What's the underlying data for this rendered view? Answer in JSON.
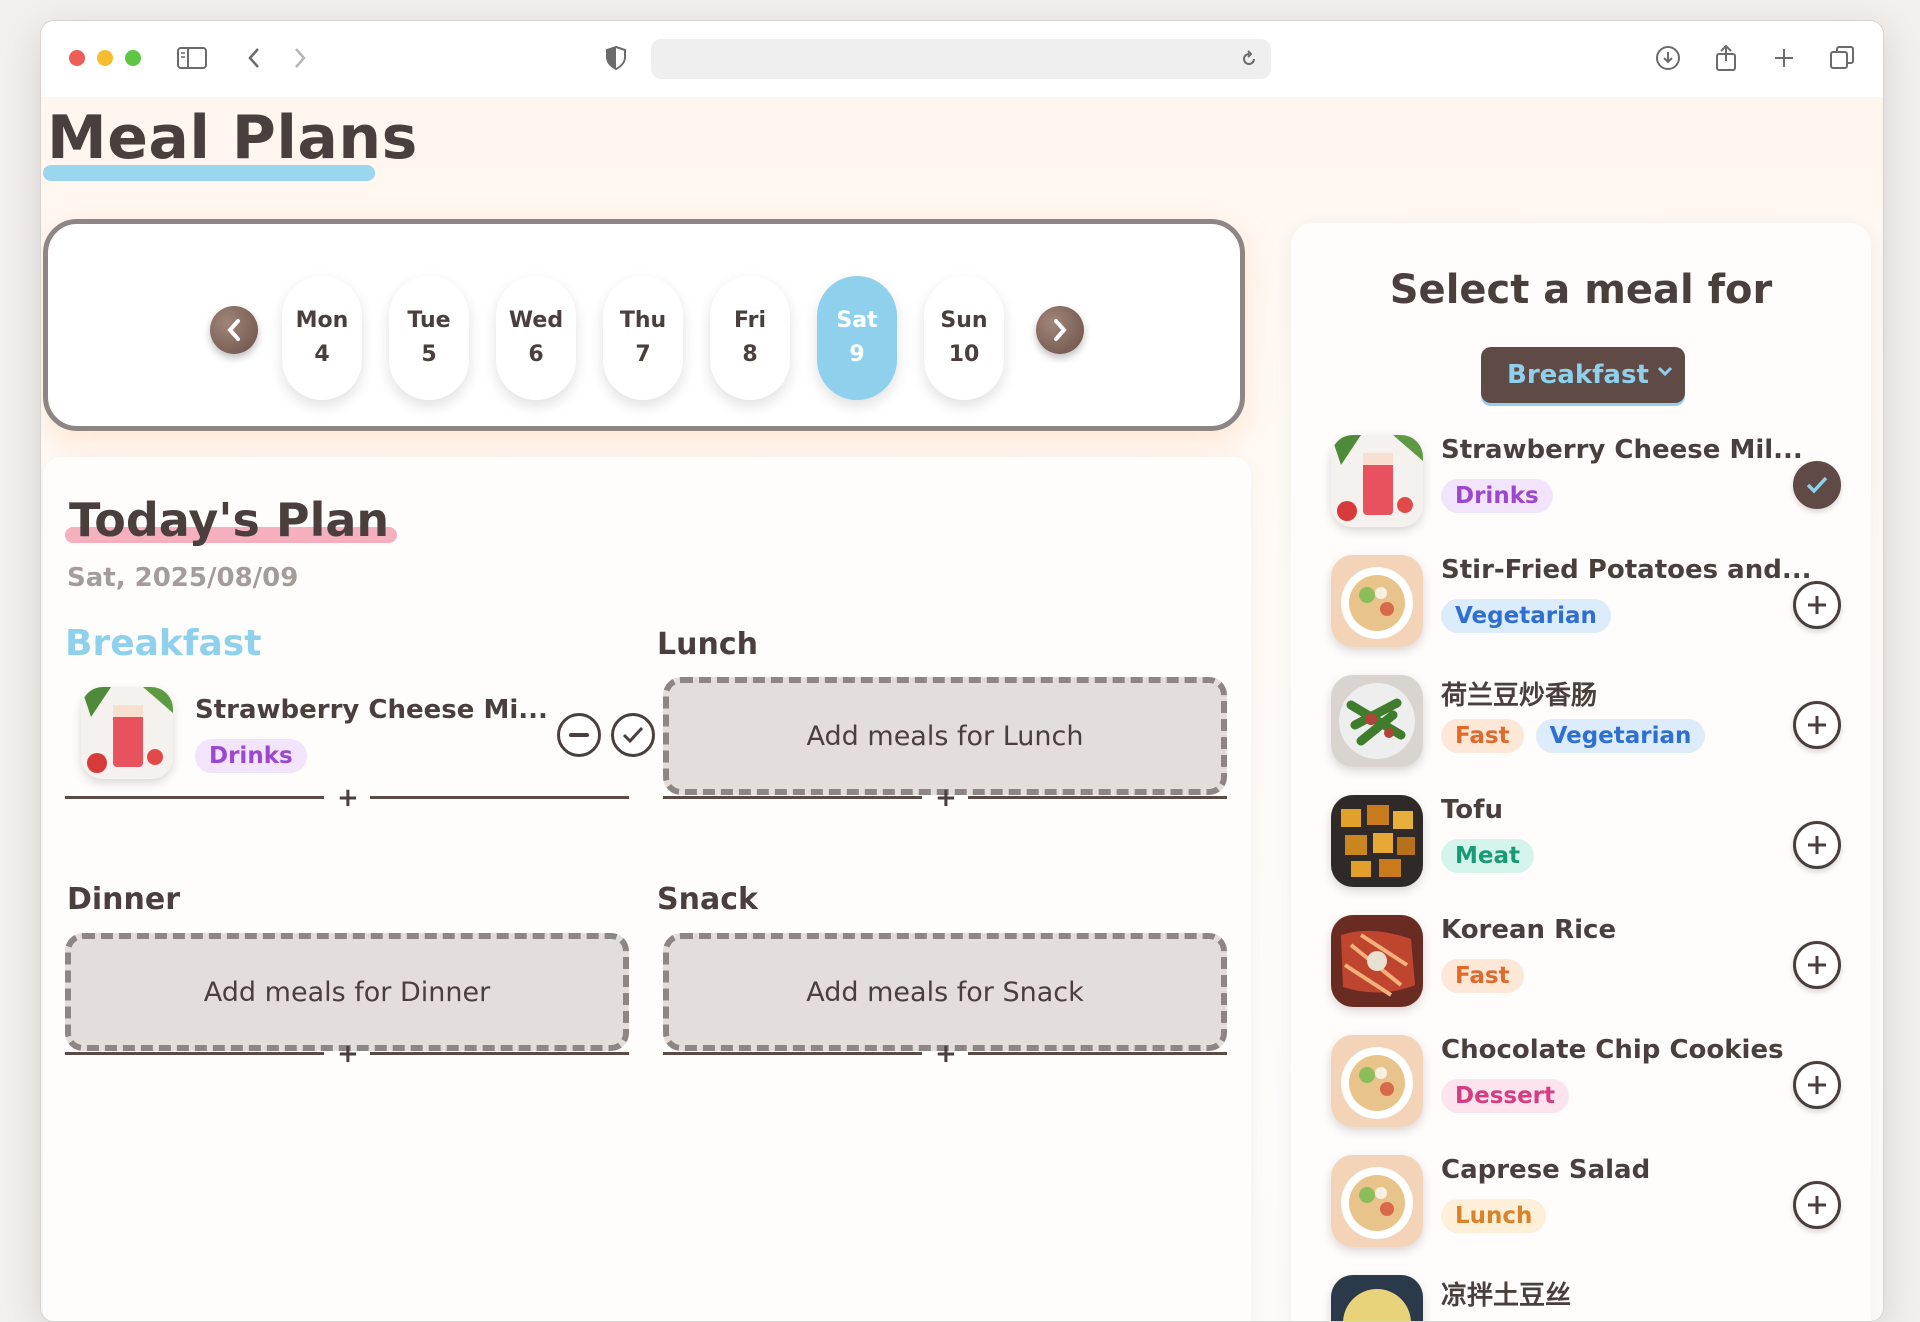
{
  "page": {
    "title": "Meal Plans"
  },
  "week": {
    "days": [
      {
        "name": "Mon",
        "num": "4"
      },
      {
        "name": "Tue",
        "num": "5"
      },
      {
        "name": "Wed",
        "num": "6"
      },
      {
        "name": "Thu",
        "num": "7"
      },
      {
        "name": "Fri",
        "num": "8"
      },
      {
        "name": "Sat",
        "num": "9"
      },
      {
        "name": "Sun",
        "num": "10"
      }
    ],
    "selected": "Sat"
  },
  "today": {
    "title": "Today's Plan",
    "date": "Sat, 2025/08/09",
    "breakfast": {
      "label": "Breakfast",
      "entry": {
        "name": "Strawberry Cheese Mi...",
        "tag": "Drinks"
      }
    },
    "lunch": {
      "label": "Lunch",
      "empty": "Add meals for Lunch"
    },
    "dinner": {
      "label": "Dinner",
      "empty": "Add meals for Dinner"
    },
    "snack": {
      "label": "Snack",
      "empty": "Add meals for Snack"
    },
    "add_symbol": "+"
  },
  "side": {
    "title": "Select a meal for",
    "meal_type": "Breakfast",
    "items": [
      {
        "name": "Strawberry Cheese Mil...",
        "tags": [
          "Drinks"
        ],
        "selected": true
      },
      {
        "name": "Stir-Fried Potatoes and...",
        "tags": [
          "Vegetarian"
        ],
        "selected": false
      },
      {
        "name": "荷兰豆炒香肠",
        "tags": [
          "Fast",
          "Vegetarian"
        ],
        "selected": false
      },
      {
        "name": "Tofu",
        "tags": [
          "Meat"
        ],
        "selected": false
      },
      {
        "name": "Korean Rice",
        "tags": [
          "Fast"
        ],
        "selected": false
      },
      {
        "name": "Chocolate Chip Cookies",
        "tags": [
          "Dessert"
        ],
        "selected": false
      },
      {
        "name": "Caprese Salad",
        "tags": [
          "Lunch"
        ],
        "selected": false
      },
      {
        "name": "凉拌土豆丝",
        "tags": [],
        "selected": false
      }
    ]
  },
  "colors": {
    "accent": "#8fd1ec",
    "brown": "#5f4a45",
    "pink": "#f3a1b2"
  }
}
